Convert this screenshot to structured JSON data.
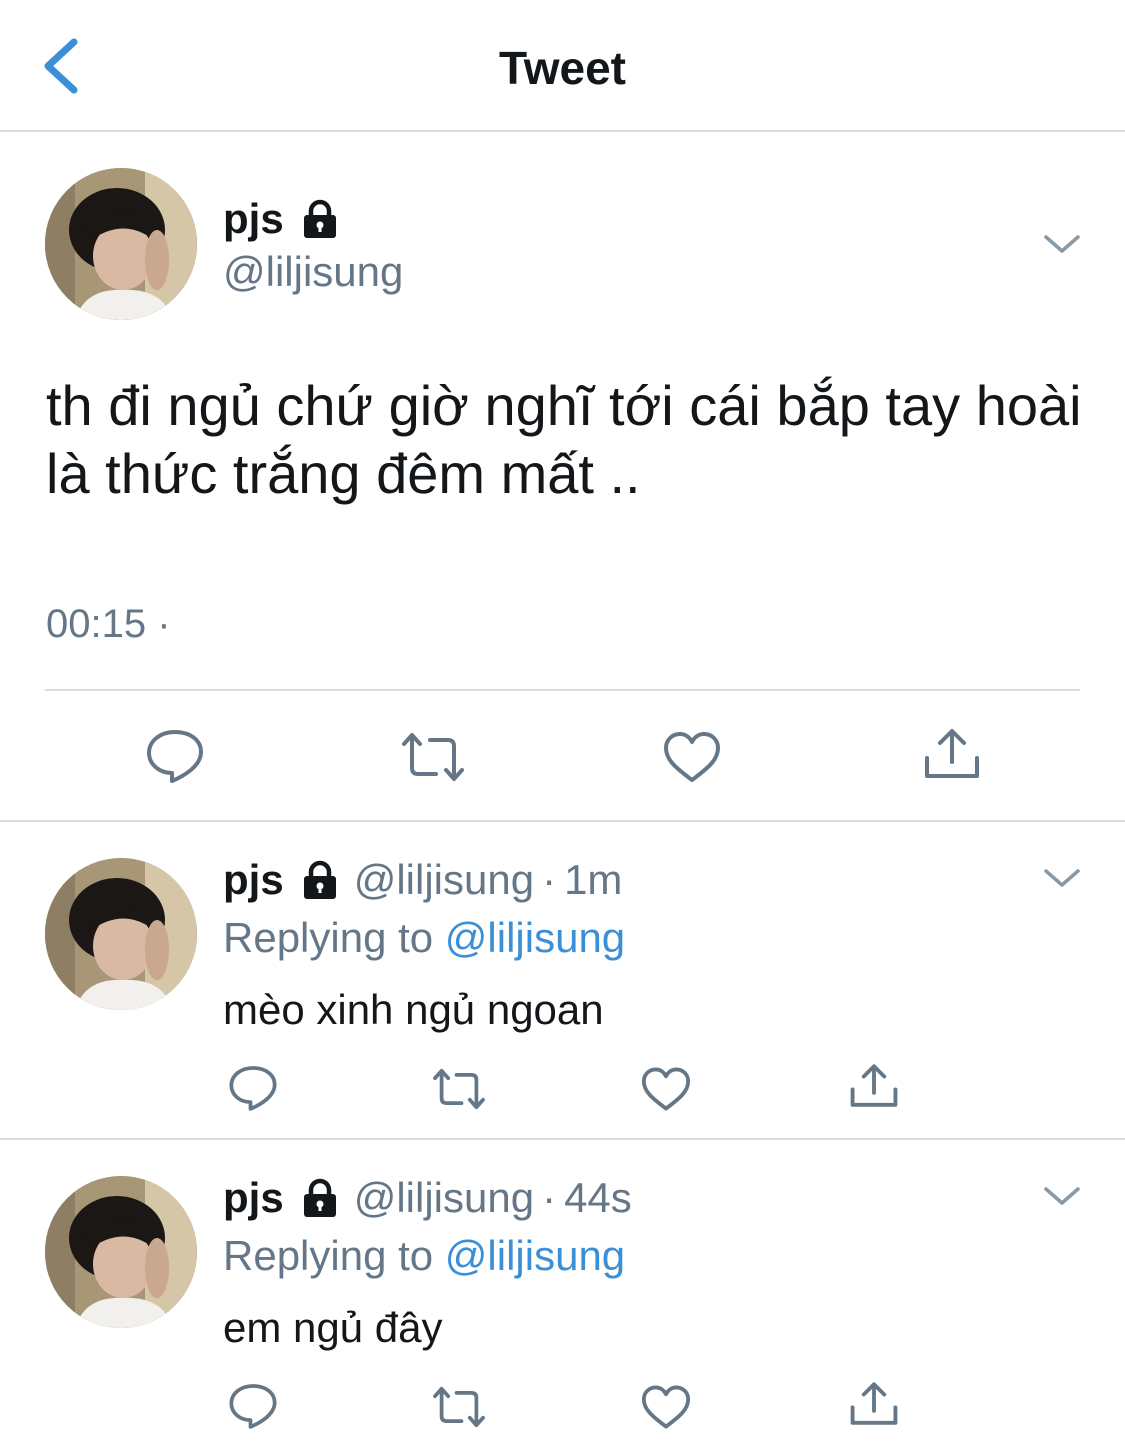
{
  "header": {
    "title": "Tweet"
  },
  "colors": {
    "text": "#14171a",
    "secondary": "#657786",
    "link": "#3b8fd6",
    "divider": "#d9dde1"
  },
  "main_tweet": {
    "name": "pjs",
    "handle": "@liljisung",
    "text": "th đi ngủ chứ giờ nghĩ tới cái bắp tay hoài là thức trắng đêm mất ..",
    "timestamp": "00:15 ·",
    "actions": [
      "reply-icon",
      "retweet-icon",
      "like-icon",
      "share-icon"
    ]
  },
  "replies": [
    {
      "name": "pjs",
      "handle": "@liljisung",
      "dot": "·",
      "time": "1m",
      "replying_prefix": "Replying to ",
      "replying_to": "@liljisung",
      "text": "mèo xinh ngủ ngoan"
    },
    {
      "name": "pjs",
      "handle": "@liljisung",
      "dot": "·",
      "time": "44s",
      "replying_prefix": "Replying to ",
      "replying_to": "@liljisung",
      "text": "em ngủ đây"
    }
  ]
}
